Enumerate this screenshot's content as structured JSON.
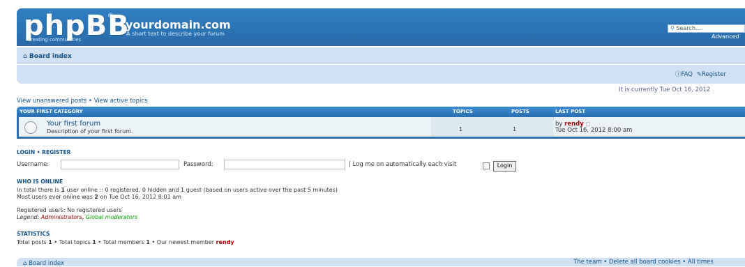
{
  "header": {
    "logo": "phpBB",
    "logo_registered": "®",
    "logo_tagline": "creating communities",
    "site_title": "yourdomain.com",
    "site_description": "A short text to describe your forum",
    "search_placeholder": "Search…",
    "advanced_search": "Advanced"
  },
  "nav": {
    "board_index": "Board index",
    "faq": "FAQ",
    "register": "Register",
    "current_time": "It is currently Tue Oct 16, 2012"
  },
  "view_links": "View unanswered posts • View active topics",
  "category": {
    "name": "YOUR FIRST CATEGORY",
    "col_topics": "TOPICS",
    "col_posts": "POSTS",
    "col_last_post": "LAST POST"
  },
  "forum": {
    "name": "Your first forum",
    "description": "Description of your first forum.",
    "topics": "1",
    "posts": "1",
    "last_post_prefix": "by",
    "last_post_user": "rendy",
    "last_post_date": "Tue Oct 16, 2012 8:00 am"
  },
  "login": {
    "title_login": "LOGIN",
    "title_sep": "•",
    "title_register": "REGISTER",
    "username_label": "Username:",
    "password_label": "Password:",
    "auto_login": "| Log me on automatically each visit",
    "login_button": "Login"
  },
  "who_is_online": {
    "title": "WHO IS ONLINE",
    "line1_a": "In total there is",
    "line1_count": "1",
    "line1_b": "user online :: 0 registered, 0 hidden and 1 guest (based on users active over the past 5 minutes)",
    "line2_a": "Most users ever online was",
    "line2_count": "2",
    "line2_b": "on Tue Oct 16, 2012 8:01 am",
    "registered": "Registered users: No registered users",
    "legend_label": "Legend:",
    "legend_admins": "Administrators",
    "legend_sep": ",",
    "legend_gmods": "Global moderators"
  },
  "statistics": {
    "title": "STATISTICS",
    "posts_label": "Total posts",
    "posts": "1",
    "topics_label": "• Total topics",
    "topics": "1",
    "members_label": "• Total members",
    "members": "1",
    "newest_label": "• Our newest member",
    "newest": "rendy"
  },
  "footer": {
    "board_index": "Board index",
    "links": "The team • Delete all board cookies • All times"
  },
  "colors": {
    "header_blue": "#2b72b3",
    "nav_light": "#cfe1f2",
    "link": "#105289",
    "admin_red": "#aa0000",
    "gmod_green": "#00aa00"
  }
}
